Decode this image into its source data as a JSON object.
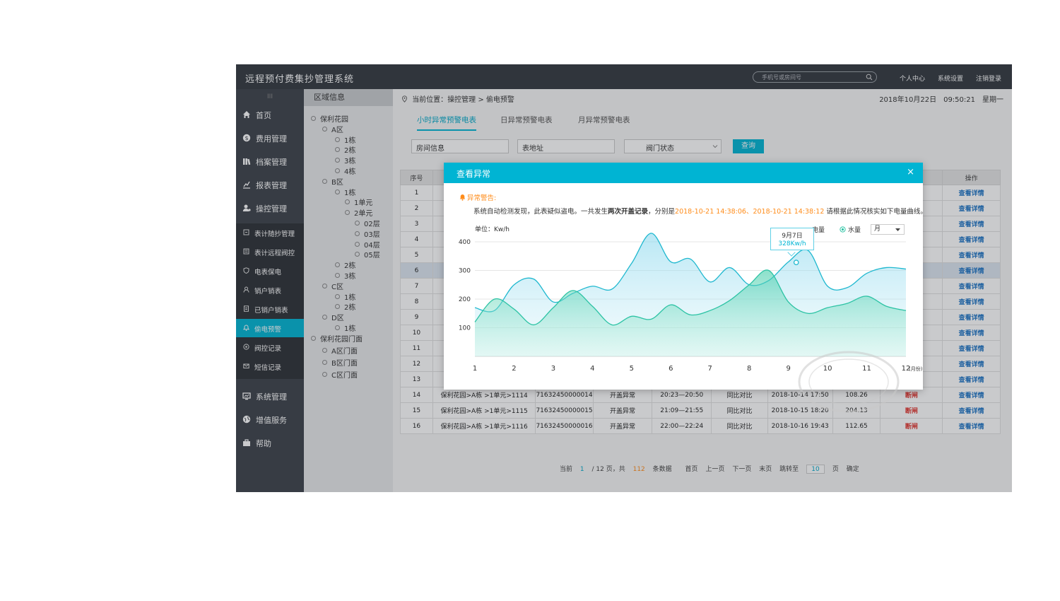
{
  "app": {
    "title": "远程预付费集抄管理系统"
  },
  "search": {
    "placeholder": "手机号或房间号"
  },
  "top_links": [
    "个人中心",
    "系统设置",
    "注销登录"
  ],
  "sidebar": {
    "grip": "III",
    "main_top": [
      {
        "label": "首页",
        "icon": "home-icon"
      },
      {
        "label": "费用管理",
        "icon": "dollar-icon"
      },
      {
        "label": "档案管理",
        "icon": "archive-icon"
      },
      {
        "label": "报表管理",
        "icon": "chart-icon"
      },
      {
        "label": "操控管理",
        "icon": "user-control-icon"
      }
    ],
    "sub": [
      {
        "label": "表计随抄管理",
        "icon": "meter-icon"
      },
      {
        "label": "表计远程阀控",
        "icon": "valve-icon"
      },
      {
        "label": "电表保电",
        "icon": "shield-icon"
      },
      {
        "label": "销户销表",
        "icon": "person-icon"
      },
      {
        "label": "已销户销表",
        "icon": "doc-icon"
      },
      {
        "label": "偷电预警",
        "icon": "bell-icon",
        "active": true
      },
      {
        "label": "阀控记录",
        "icon": "record-icon"
      },
      {
        "label": "短信记录",
        "icon": "mail-icon"
      }
    ],
    "main_bottom": [
      {
        "label": "系统管理",
        "icon": "monitor-icon"
      },
      {
        "label": "增值服务",
        "icon": "globe-icon"
      },
      {
        "label": "帮助",
        "icon": "briefcase-icon"
      }
    ]
  },
  "tree": {
    "title": "区域信息",
    "nodes": [
      {
        "label": "保利花园",
        "level": 0
      },
      {
        "label": "A区",
        "level": 1
      },
      {
        "label": "1栋",
        "level": 2
      },
      {
        "label": "2栋",
        "level": 2
      },
      {
        "label": "3栋",
        "level": 2
      },
      {
        "label": "4栋",
        "level": 2
      },
      {
        "label": "B区",
        "level": 1
      },
      {
        "label": "1栋",
        "level": 2
      },
      {
        "label": "1单元",
        "level": 3
      },
      {
        "label": "2单元",
        "level": 3
      },
      {
        "label": "02层",
        "level": 4
      },
      {
        "label": "03层",
        "level": 4
      },
      {
        "label": "04层",
        "level": 4
      },
      {
        "label": "05层",
        "level": 4
      },
      {
        "label": "2栋",
        "level": 2
      },
      {
        "label": "3栋",
        "level": 2
      },
      {
        "label": "C区",
        "level": 1
      },
      {
        "label": "1栋",
        "level": 2
      },
      {
        "label": "2栋",
        "level": 2
      },
      {
        "label": "D区",
        "level": 1
      },
      {
        "label": "1栋",
        "level": 2
      },
      {
        "label": "保利花园门面",
        "level": 0
      },
      {
        "label": "A区门面",
        "level": 1
      },
      {
        "label": "B区门面",
        "level": 1
      },
      {
        "label": "C区门面",
        "level": 1
      }
    ]
  },
  "breadcrumb": {
    "prefix": "当前位置：",
    "path": "操控管理",
    "sep": " > ",
    "current": "偷电预警"
  },
  "datetime": "2018年10月22日　09:50:21　星期一",
  "tabs": [
    "小时异常预警电表",
    "日异常预警电表",
    "月异常预警电表"
  ],
  "filters": {
    "room": "房间信息",
    "address": "表地址",
    "valve": "阀门状态",
    "query": "查询"
  },
  "table": {
    "col_seq": "序号",
    "col_action": "操作",
    "action_label": "查看详情",
    "rows": [
      {
        "seq": "1"
      },
      {
        "seq": "2"
      },
      {
        "seq": "3"
      },
      {
        "seq": "4"
      },
      {
        "seq": "5"
      },
      {
        "seq": "6"
      },
      {
        "seq": "7"
      },
      {
        "seq": "8"
      },
      {
        "seq": "9"
      },
      {
        "seq": "10"
      },
      {
        "seq": "11"
      },
      {
        "seq": "12"
      },
      {
        "seq": "13"
      },
      {
        "seq": "14",
        "room": "保利花园>A栋 >1单元>1114",
        "meter": "71632450000014",
        "type": "开盖异常",
        "time": "20:23—20:50",
        "cmp": "同比对比",
        "date": "2018-10-14 17:50",
        "val": "108.26",
        "status": "断闸"
      },
      {
        "seq": "15",
        "room": "保利花园>A栋 >1单元>1115",
        "meter": "71632450000015",
        "type": "开盖异常",
        "time": "21:09—21:55",
        "cmp": "同比对比",
        "date": "2018-10-15 18:20",
        "val": "204.13",
        "status": "断闸"
      },
      {
        "seq": "16",
        "room": "保利花园>A栋 >1单元>1116",
        "meter": "71632450000016",
        "type": "开盖异常",
        "time": "22:00—22:24",
        "cmp": "同比对比",
        "date": "2018-10-16 19:43",
        "val": "112.65",
        "status": "断闸"
      }
    ]
  },
  "pager": {
    "current_label": "当前",
    "current": "1",
    "total_pages": "/ 12 页，共",
    "total": "112",
    "records": "条数据",
    "first": "首页",
    "prev": "上一页",
    "next": "下一页",
    "last": "末页",
    "jump_label": "跳转至",
    "jump": "10",
    "page_unit": "页",
    "confirm": "确定"
  },
  "modal": {
    "title": "查看异常",
    "close": "×",
    "warn_title": "异常警告:",
    "warn_prefix": "系统自动检测发现，此表疑似盗电。一共发生",
    "warn_bold": "两次开盖记录",
    "warn_mid": "，分别是",
    "date1": "2018-10-21 14:38:06",
    "sep": "、",
    "date2": "2018-10-21 14:38:12",
    "warn_suffix": "请根据此情况核实如下电量曲线。",
    "legend_power": "电量",
    "legend_water": "水量",
    "period": "月",
    "tooltip_date": "9月7日",
    "tooltip_value": "328Kw/h"
  },
  "colors": {
    "accent": "#00b4d3",
    "series_power": "#1fb8cf",
    "series_water": "#2cc3a4",
    "warning": "#ff8c1a",
    "danger": "#e0302a"
  },
  "chart_data": {
    "type": "area",
    "ylabel": "单位：Kw/h",
    "x": [
      1,
      2,
      3,
      4,
      5,
      6,
      7,
      8,
      9,
      10,
      11,
      12
    ],
    "x_unit": "(月份)",
    "yticks": [
      100,
      200,
      300,
      400
    ],
    "ylim": [
      0,
      400
    ],
    "grid": true,
    "legend": "top-right",
    "series": [
      {
        "name": "电量",
        "color": "#1fb8cf",
        "x": [
          1,
          1.5,
          2,
          2.5,
          3,
          3.5,
          4,
          4.5,
          5,
          5.5,
          6,
          6.5,
          7,
          7.5,
          8,
          8.5,
          9,
          9.5,
          10,
          10.5,
          11,
          11.5,
          12
        ],
        "values": [
          170,
          160,
          250,
          270,
          190,
          220,
          245,
          235,
          325,
          430,
          330,
          340,
          260,
          310,
          250,
          265,
          330,
          370,
          245,
          240,
          290,
          310,
          305
        ]
      },
      {
        "name": "水量",
        "color": "#2cc3a4",
        "x": [
          1,
          1.5,
          2,
          2.5,
          3,
          3.5,
          4,
          4.5,
          5,
          5.5,
          6,
          6.5,
          7,
          7.5,
          8,
          8.5,
          9,
          9.5,
          10,
          10.5,
          11,
          11.5,
          12
        ],
        "values": [
          120,
          200,
          165,
          110,
          170,
          230,
          175,
          110,
          140,
          130,
          180,
          145,
          160,
          195,
          250,
          300,
          190,
          150,
          170,
          185,
          210,
          175,
          160
        ]
      }
    ],
    "highlight": {
      "series": "电量",
      "x": 9.2,
      "y": 328
    }
  }
}
